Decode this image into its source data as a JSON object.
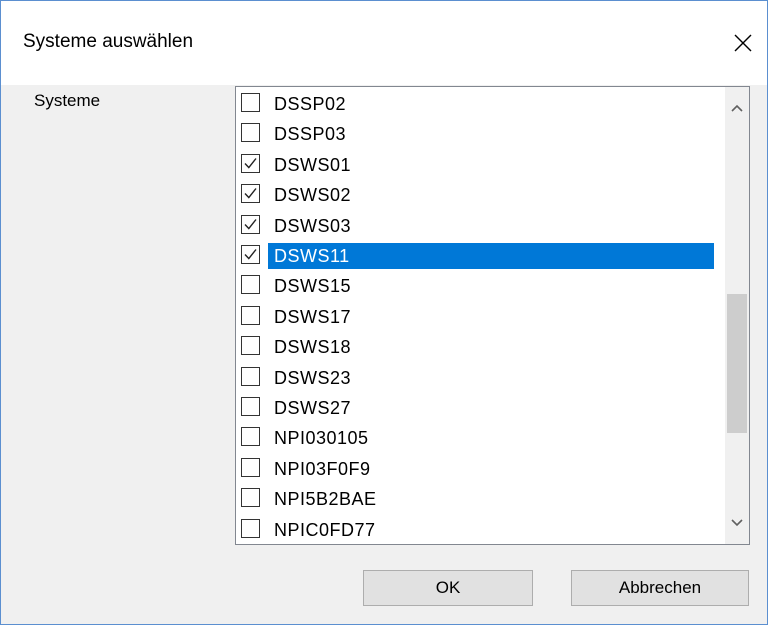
{
  "dialog": {
    "title": "Systeme auswählen",
    "close_icon": "close-icon"
  },
  "systems_label": "Systeme",
  "items": [
    {
      "label": "DSSP02",
      "checked": false,
      "selected": false
    },
    {
      "label": "DSSP03",
      "checked": false,
      "selected": false
    },
    {
      "label": "DSWS01",
      "checked": true,
      "selected": false
    },
    {
      "label": "DSWS02",
      "checked": true,
      "selected": false
    },
    {
      "label": "DSWS03",
      "checked": true,
      "selected": false
    },
    {
      "label": "DSWS11",
      "checked": true,
      "selected": true
    },
    {
      "label": "DSWS15",
      "checked": false,
      "selected": false
    },
    {
      "label": "DSWS17",
      "checked": false,
      "selected": false
    },
    {
      "label": "DSWS18",
      "checked": false,
      "selected": false
    },
    {
      "label": "DSWS23",
      "checked": false,
      "selected": false
    },
    {
      "label": "DSWS27",
      "checked": false,
      "selected": false
    },
    {
      "label": "NPI030105",
      "checked": false,
      "selected": false
    },
    {
      "label": "NPI03F0F9",
      "checked": false,
      "selected": false
    },
    {
      "label": "NPI5B2BAE",
      "checked": false,
      "selected": false
    },
    {
      "label": "NPIC0FD77",
      "checked": false,
      "selected": false
    }
  ],
  "buttons": {
    "ok_label": "OK",
    "cancel_label": "Abbrechen"
  },
  "colors": {
    "selection": "#0078d7",
    "dialog_border": "#5b8fd0",
    "dialog_bg": "#f0f0f0"
  }
}
